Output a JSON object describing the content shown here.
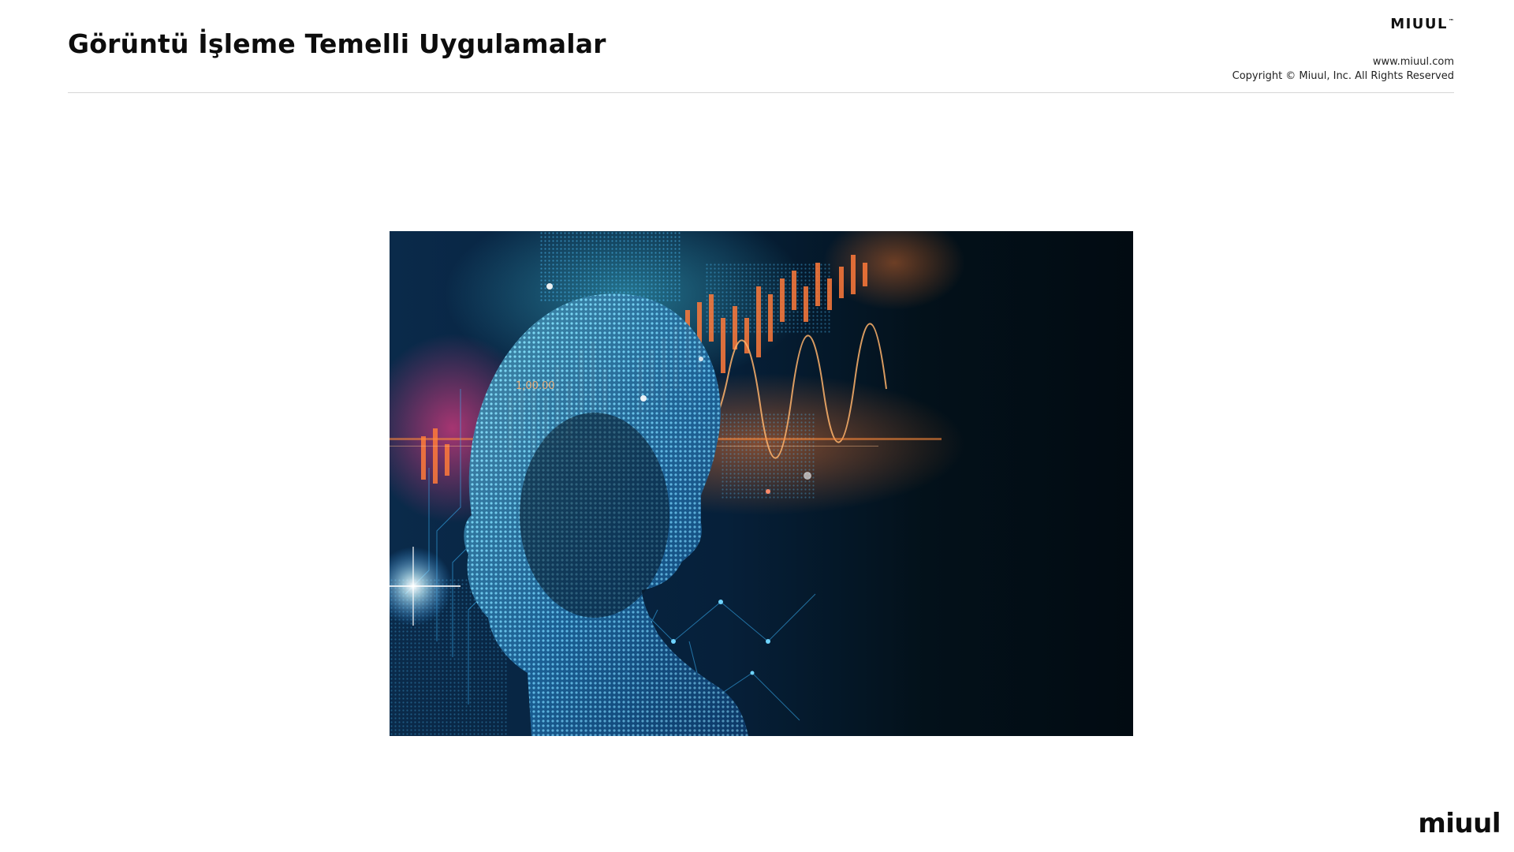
{
  "slide": {
    "title": "Görüntü İşleme Temelli Uygulamalar"
  },
  "header": {
    "brand": "MIUUL",
    "brand_mark": "™",
    "website": "www.miuul.com",
    "copyright": "Copyright © Miuul, Inc. All Rights Reserved"
  },
  "figure": {
    "overlay_text": "1,00.00"
  },
  "footer": {
    "logo": "miuul"
  },
  "colors": {
    "background": "#ffffff",
    "text": "#0d0d0d",
    "divider": "#d6d6d6",
    "image_dark": "#03111a",
    "image_cyan": "#2fd3ff",
    "image_orange": "#ff7a2e"
  }
}
